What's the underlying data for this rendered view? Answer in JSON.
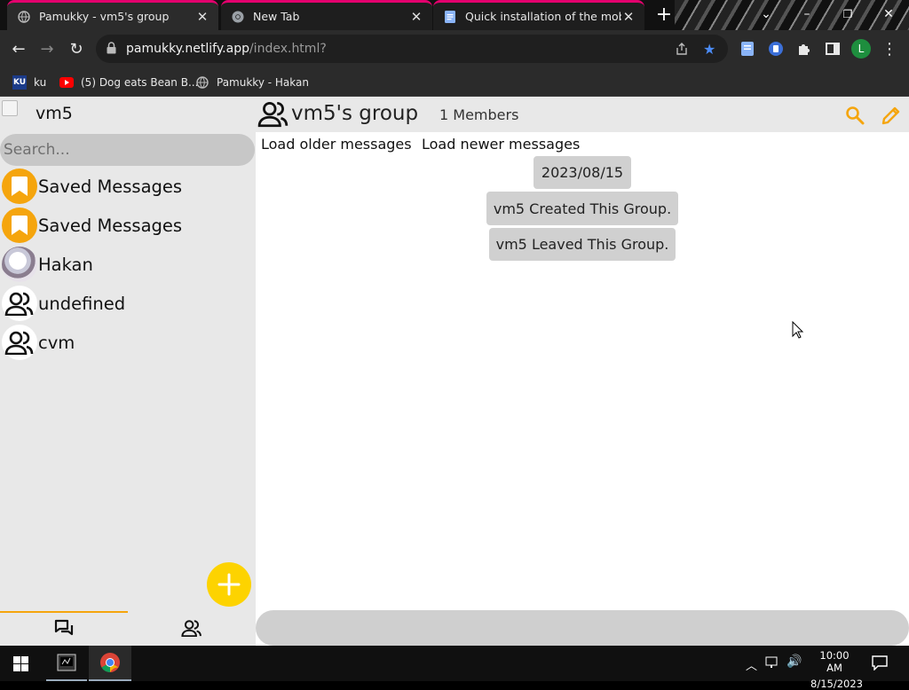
{
  "browser": {
    "tabs": [
      {
        "title": "Pamukky - vm5's group",
        "active": true
      },
      {
        "title": "New Tab",
        "active": false
      },
      {
        "title": "Quick installation of the mobile s",
        "active": false
      }
    ],
    "url_host": "pamukky.netlify.app",
    "url_path": "/index.html?",
    "profile_initial": "L",
    "bookmarks": [
      {
        "label": "ku",
        "icon": "ku-logo-icon"
      },
      {
        "label": "(5) Dog eats Bean B...",
        "icon": "youtube-icon"
      },
      {
        "label": "Pamukky - Hakan",
        "icon": "globe-icon"
      }
    ]
  },
  "sidebar": {
    "username": "vm5",
    "search_placeholder": "Search...",
    "chats": [
      {
        "name": "Saved Messages",
        "avatar": "bookmark-icon"
      },
      {
        "name": "Saved Messages",
        "avatar": "bookmark-icon"
      },
      {
        "name": "Hakan",
        "avatar": "photo-avatar"
      },
      {
        "name": "undefined",
        "avatar": "group-icon"
      },
      {
        "name": "cvm",
        "avatar": "group-icon"
      }
    ]
  },
  "main": {
    "group_name": "vm5's group",
    "members": "1 Members",
    "load_older": "Load older messages",
    "load_newer": "Load newer messages",
    "messages": [
      {
        "text": "2023/08/15",
        "kind": "date"
      },
      {
        "text": "vm5 Created This Group.",
        "kind": "system"
      },
      {
        "text": "vm5 Leaved This Group.",
        "kind": "system"
      }
    ]
  },
  "taskbar": {
    "time": "10:00 AM",
    "date": "8/15/2023"
  },
  "colors": {
    "accent": "#f5a50d",
    "fab": "#fdd300",
    "tab_highlight": "#e3006d"
  }
}
